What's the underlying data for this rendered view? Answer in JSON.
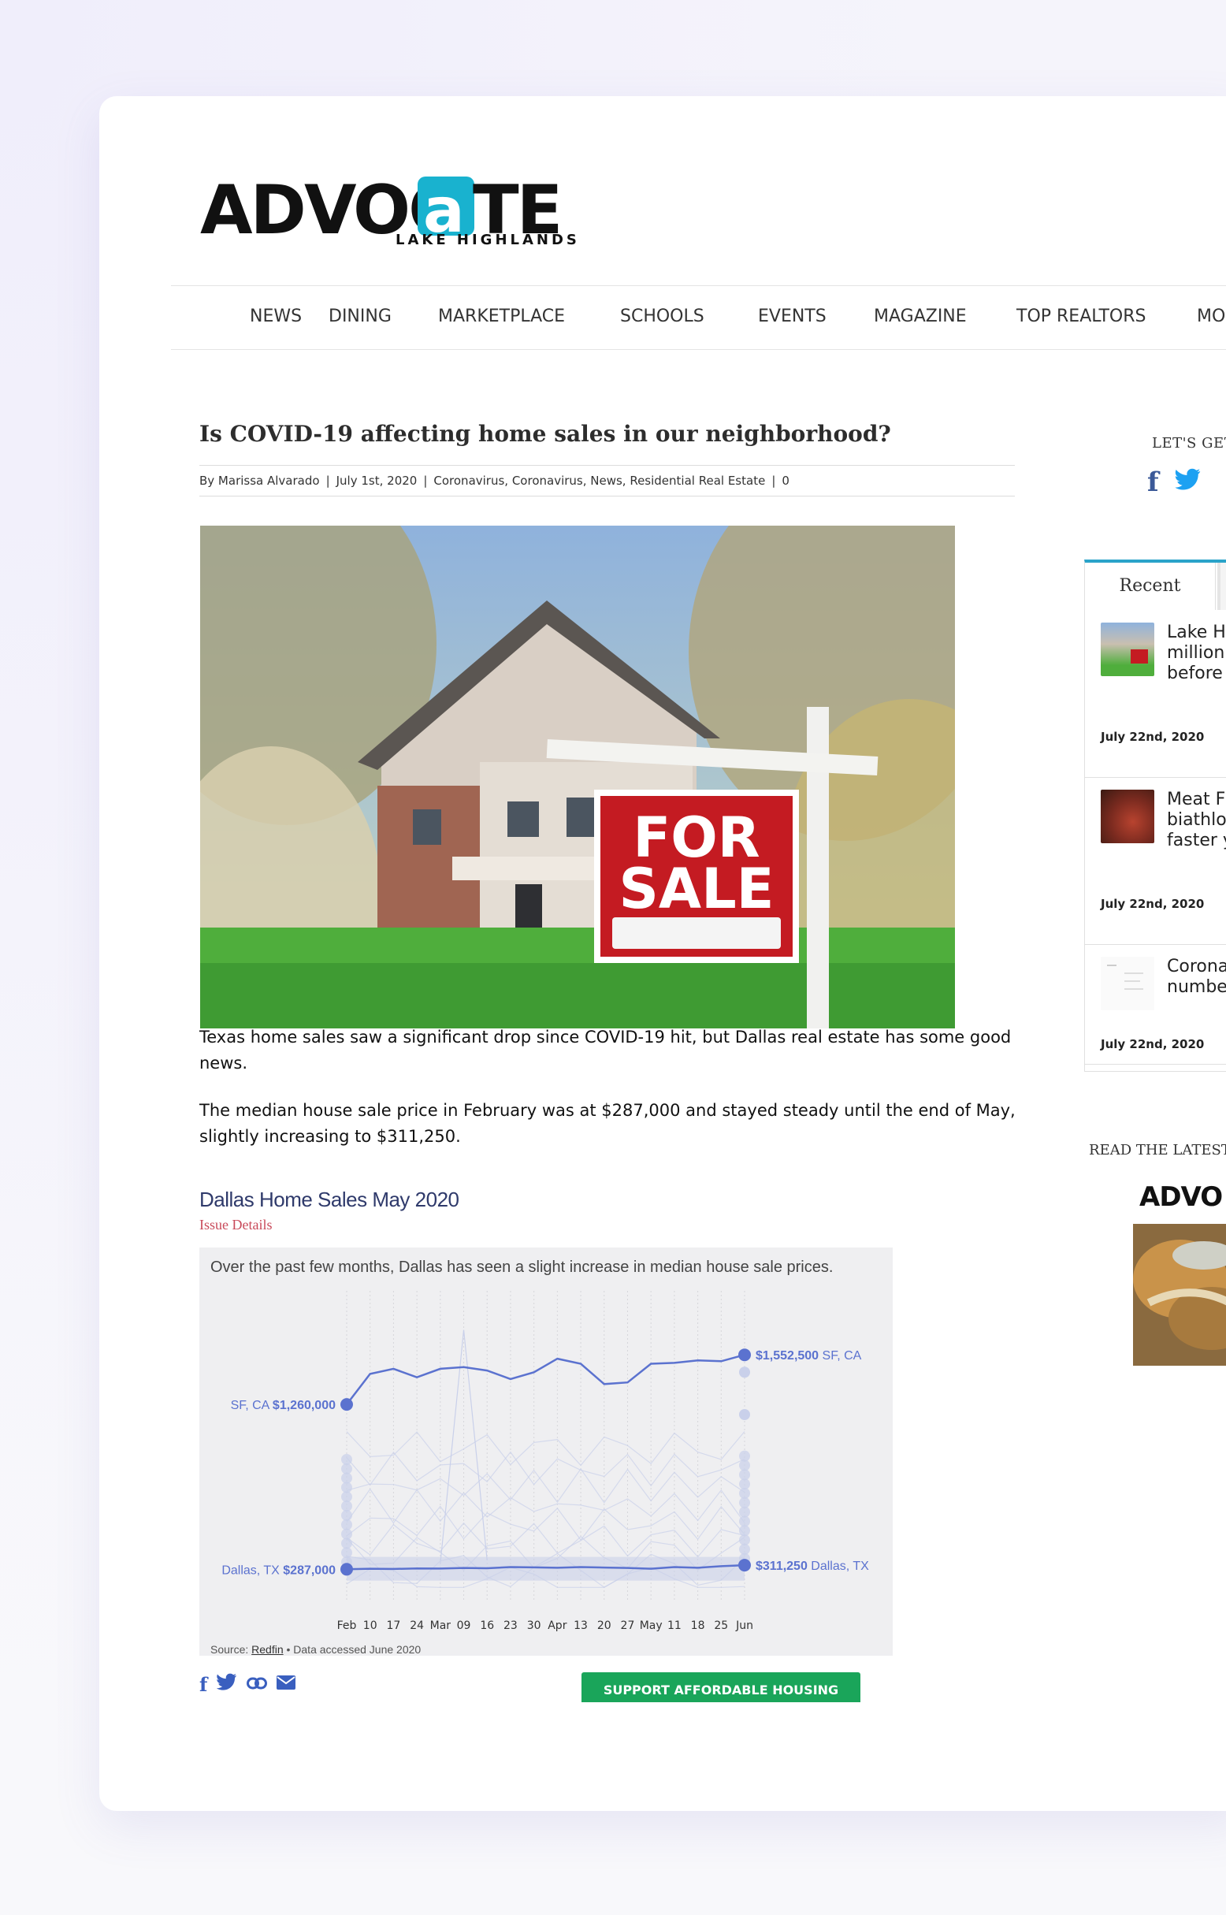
{
  "site": {
    "logo_main": "ADVOCATE",
    "logo_sub": "LAKE HIGHLANDS"
  },
  "nav": {
    "items": [
      "NEWS",
      "DINING",
      "MARKETPLACE",
      "SCHOOLS",
      "EVENTS",
      "MAGAZINE",
      "TOP REALTORS",
      "MO"
    ]
  },
  "article": {
    "title": "Is COVID-19 affecting home sales in our neighborhood?",
    "meta": {
      "author": "By Marissa Alvarado",
      "date": "July 1st, 2020",
      "categories": "Coronavirus, Coronavirus, News, Residential Real Estate",
      "comments": "0"
    },
    "hero_sign_line1": "FOR",
    "hero_sign_line2": "SALE",
    "paragraph1": "Texas home sales saw a significant drop since COVID-19 hit, but Dallas real estate has some good news.",
    "paragraph2": "The median house sale price in February was at $287,000 and stayed steady until the end of May, slightly increasing to $311,250."
  },
  "chart_data": {
    "type": "line",
    "title": "Dallas Home Sales May 2020",
    "subtitle": "Issue Details",
    "description": "Over the past few months, Dallas has seen a slight increase in median house sale prices.",
    "source_prefix": "Source: ",
    "source_link": "Redfin",
    "source_suffix": " • Data accessed June 2020",
    "x_ticks": [
      "Feb",
      "10",
      "17",
      "24",
      "Mar",
      "09",
      "16",
      "23",
      "30",
      "Apr",
      "13",
      "20",
      "27",
      "May",
      "11",
      "18",
      "25",
      "Jun"
    ],
    "series": [
      {
        "name": "SF, CA",
        "start_label": "SF, CA",
        "start_value_label": "$1,260,000",
        "end_value_label": "$1,552,500",
        "end_label": "SF, CA",
        "values": [
          1260000,
          1440000,
          1470000,
          1420000,
          1470000,
          1480000,
          1460000,
          1410000,
          1450000,
          1530000,
          1500000,
          1380000,
          1390000,
          1500000,
          1505000,
          1520000,
          1515000,
          1552500
        ]
      },
      {
        "name": "Dallas, TX",
        "start_label": "Dallas, TX",
        "start_value_label": "$287,000",
        "end_value_label": "$311,250",
        "end_label": "Dallas, TX",
        "values": [
          287000,
          290000,
          289000,
          292000,
          291000,
          295000,
          293000,
          300000,
          298000,
          296000,
          300000,
          297000,
          295000,
          290000,
          300000,
          296000,
          305000,
          311250
        ]
      }
    ],
    "ylim": [
      0,
      2000000
    ],
    "colors": {
      "highlight": "#5b72cf",
      "background_lines": "#c9d0ea"
    }
  },
  "share": {
    "icons": [
      "facebook-icon",
      "twitter-icon",
      "link-icon",
      "email-icon"
    ]
  },
  "support_button": "SUPPORT AFFORDABLE HOUSING",
  "sidebar": {
    "social_heading": "LET'S GET",
    "tab_recent": "Recent",
    "posts": [
      {
        "title": "Lake H selling million homes before",
        "date": "July 22nd, 2020"
      },
      {
        "title": "Meat F hosting biathlo more y faster y",
        "date": "July 22nd, 2020"
      },
      {
        "title": "Corona Tracke numbe need t",
        "date": "July 22nd, 2020"
      }
    ],
    "latest_heading": "READ THE LATEST I",
    "magazine_logo": "ADVO"
  }
}
